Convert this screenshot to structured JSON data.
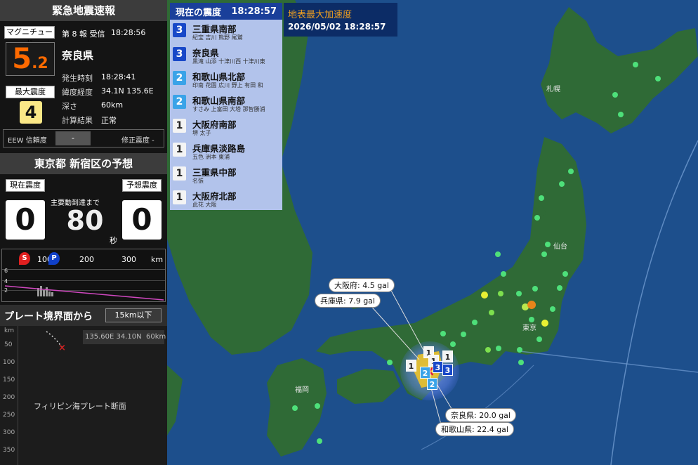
{
  "eew": {
    "title": "緊急地震速報",
    "magnitude_label": "マグニチュード",
    "report_no": "第 8 報 受信",
    "received_time": "18:28:56",
    "magnitude_int": "5",
    "magnitude_dec": ".2",
    "region": "奈良県",
    "origin_time_label": "発生時刻",
    "origin_time": "18:28:41",
    "coord_label": "緯度経度",
    "coord": "34.1N 135.6E",
    "depth_label": "深さ",
    "depth": "60km",
    "calc_label": "計算結果",
    "calc": "正常",
    "max_int_label": "最大震度",
    "max_int": "4",
    "reliability_label": "EEW 信頼度",
    "reliability": "-",
    "corr_label": "修正震度 -"
  },
  "forecast": {
    "title": "東京都 新宿区の予想",
    "current_label": "現在震度",
    "expected_label": "予想震度",
    "current": "0",
    "expected": "0",
    "arrival_label": "主要動到達まで",
    "seconds": "80",
    "sec_unit": "秒"
  },
  "wave": {
    "s_label": "S",
    "p_label": "P",
    "ticks": [
      "100",
      "200",
      "300"
    ],
    "unit": "km",
    "y_ticks": [
      "6",
      "4",
      "2"
    ]
  },
  "plate": {
    "title": "プレート境界面から",
    "depth_badge": "15km以下",
    "coords": "135.60E 34.10N",
    "depth": "60km",
    "axis_unit": "km",
    "ticks": [
      "50",
      "100",
      "150",
      "200",
      "250",
      "300",
      "350"
    ],
    "plate_name": "フィリピン海プレート断面"
  },
  "intensity_list": {
    "title": "現在の震度",
    "time": "18:28:57",
    "rows": [
      {
        "shindo": "3",
        "name": "三重県南部",
        "cities": "紀宝 吉川 熊野 尾鷲",
        "bg": "#1848c8",
        "fg": "#ffffff"
      },
      {
        "shindo": "3",
        "name": "奈良県",
        "cities": "黒滝 山添 十津川西 十津川東",
        "bg": "#1848c8",
        "fg": "#ffffff"
      },
      {
        "shindo": "2",
        "name": "和歌山県北部",
        "cities": "印南 花園 広川 野上 有田 和",
        "bg": "#3aa3e8",
        "fg": "#ffffff"
      },
      {
        "shindo": "2",
        "name": "和歌山県南部",
        "cities": "すさみ 上富田 大塔 那智勝浦",
        "bg": "#3aa3e8",
        "fg": "#ffffff"
      },
      {
        "shindo": "1",
        "name": "大阪府南部",
        "cities": "堺 太子",
        "bg": "#f4f4f4",
        "fg": "#222222"
      },
      {
        "shindo": "1",
        "name": "兵庫県淡路島",
        "cities": "五色 洲本 東浦",
        "bg": "#f4f4f4",
        "fg": "#222222"
      },
      {
        "shindo": "1",
        "name": "三重県中部",
        "cities": "名張",
        "bg": "#f4f4f4",
        "fg": "#222222"
      },
      {
        "shindo": "1",
        "name": "大阪府北部",
        "cities": "此花 大阪",
        "bg": "#f4f4f4",
        "fg": "#222222"
      }
    ]
  },
  "pga": {
    "title": "地表最大加速度",
    "datetime": "2026/05/02 18:28:57"
  },
  "callouts": {
    "osaka": "大阪府: 4.5 gal",
    "hyogo": "兵庫県: 7.9 gal",
    "nara": "奈良県: 20.0 gal",
    "wakayama": "和歌山県: 22.4 gal"
  },
  "map_labels": {
    "sapporo": "札幌",
    "sendai": "仙台",
    "tokyo": "東京",
    "fukuoka": "福岡"
  },
  "markers": [
    "1",
    "1",
    "1",
    "1",
    "1",
    "3",
    "3",
    "2",
    "2"
  ],
  "colors": {
    "sea": "#1d4f8c",
    "land": "#2f6a36",
    "shindo1": "#f4f4f4",
    "shindo2": "#3aa3e8",
    "shindo3": "#1848c8",
    "magnitude": "#ff6a00"
  }
}
